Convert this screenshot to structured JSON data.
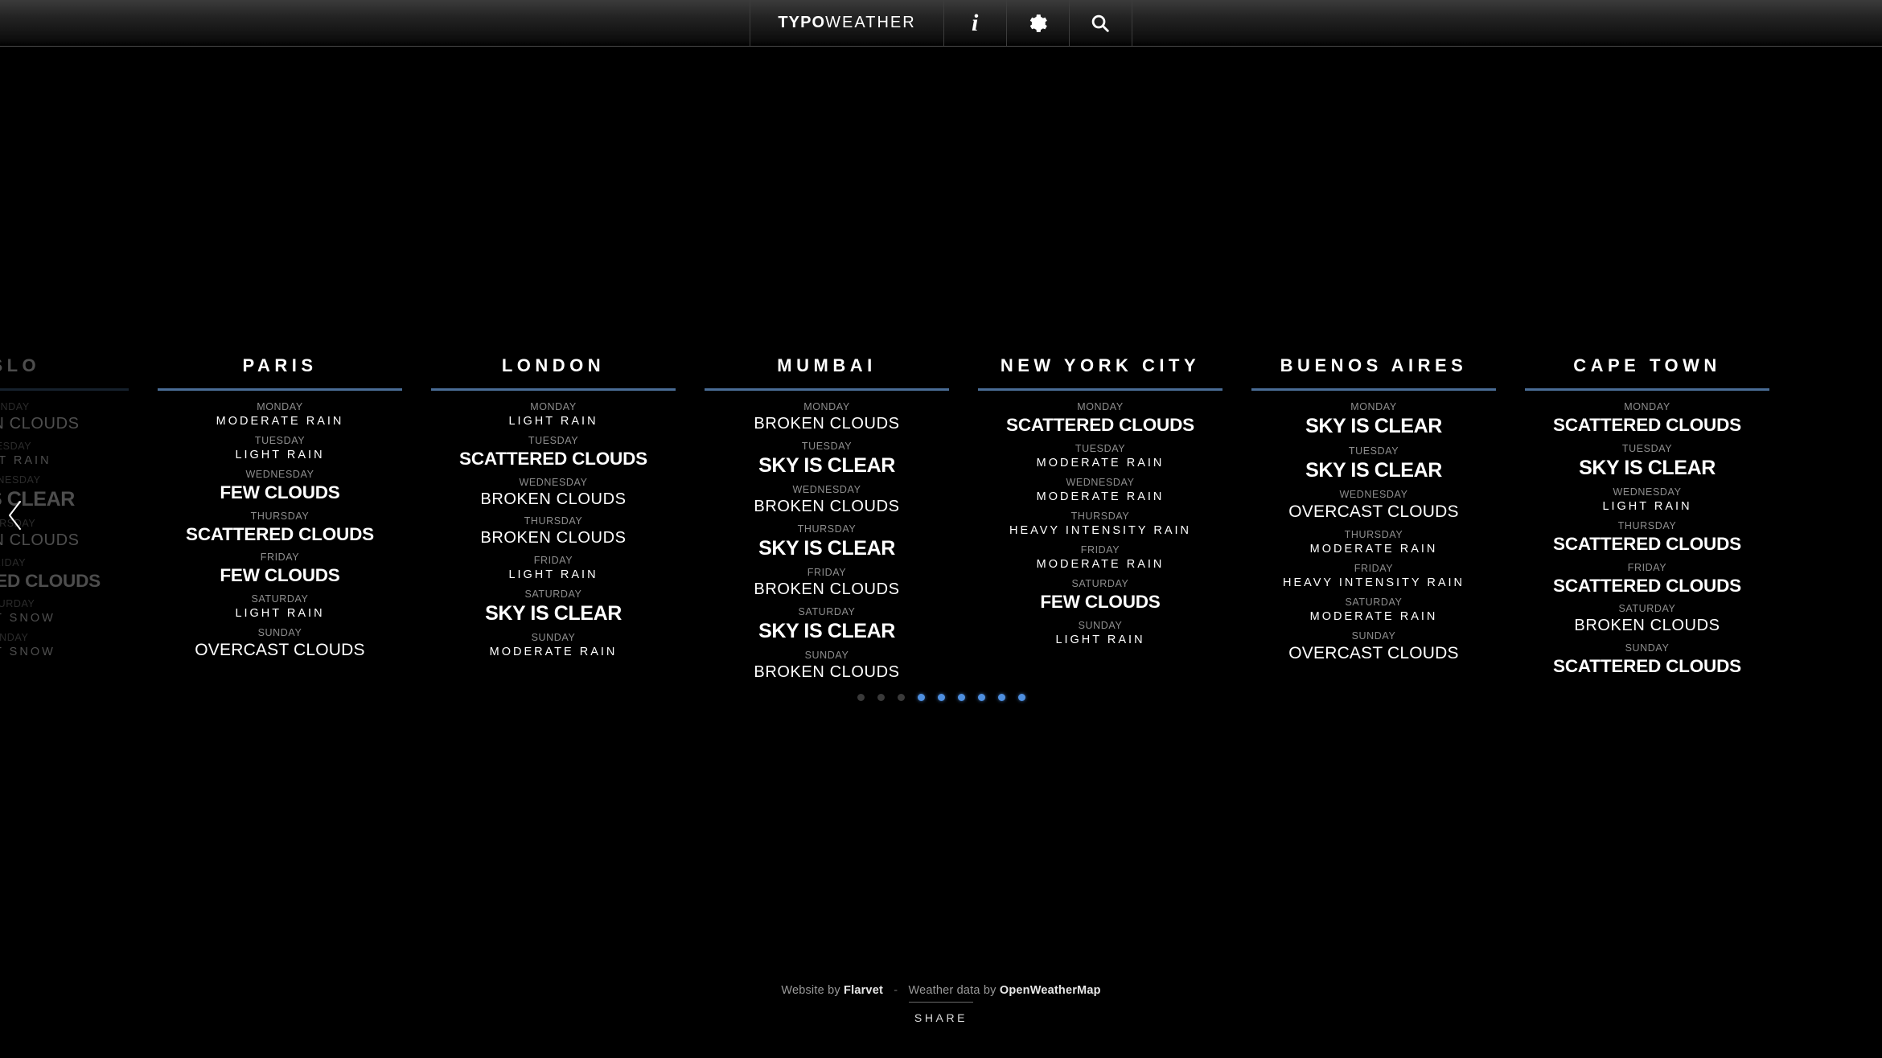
{
  "header": {
    "brand_bold": "TYPO",
    "brand_light": "WEATHER",
    "info_label": "i",
    "icons": {
      "info": "info-icon",
      "settings": "gear-icon",
      "search": "search-icon"
    }
  },
  "carousel": {
    "prev_label": "‹",
    "accent_color": "#4a6d96",
    "dot_active_color": "#4e8fe0",
    "dot_inactive_color": "#3a3a3a",
    "dots": [
      {
        "state": "off"
      },
      {
        "state": "off"
      },
      {
        "state": "off"
      },
      {
        "state": "on"
      },
      {
        "state": "on"
      },
      {
        "state": "on"
      },
      {
        "state": "on"
      },
      {
        "state": "on"
      },
      {
        "state": "on"
      }
    ],
    "cards": [
      {
        "city": "OSLO",
        "days": [
          {
            "day": "MONDAY",
            "condition": "BROKEN CLOUDS",
            "weight": "w-reg"
          },
          {
            "day": "TUESDAY",
            "condition": "LIGHT RAIN",
            "weight": "w-thin"
          },
          {
            "day": "WEDNESDAY",
            "condition": "SKY IS CLEAR",
            "weight": "w-xbold"
          },
          {
            "day": "THURSDAY",
            "condition": "BROKEN CLOUDS",
            "weight": "w-reg"
          },
          {
            "day": "FRIDAY",
            "condition": "SCATTERED CLOUDS",
            "weight": "w-bold"
          },
          {
            "day": "SATURDAY",
            "condition": "LIGHT SNOW",
            "weight": "w-thin"
          },
          {
            "day": "SUNDAY",
            "condition": "LIGHT SNOW",
            "weight": "w-thin"
          }
        ]
      },
      {
        "city": "PARIS",
        "days": [
          {
            "day": "MONDAY",
            "condition": "MODERATE RAIN",
            "weight": "w-thin"
          },
          {
            "day": "TUESDAY",
            "condition": "LIGHT RAIN",
            "weight": "w-thin"
          },
          {
            "day": "WEDNESDAY",
            "condition": "FEW CLOUDS",
            "weight": "w-bold"
          },
          {
            "day": "THURSDAY",
            "condition": "SCATTERED CLOUDS",
            "weight": "w-bold"
          },
          {
            "day": "FRIDAY",
            "condition": "FEW CLOUDS",
            "weight": "w-bold"
          },
          {
            "day": "SATURDAY",
            "condition": "LIGHT RAIN",
            "weight": "w-thin"
          },
          {
            "day": "SUNDAY",
            "condition": "OVERCAST CLOUDS",
            "weight": "w-mid"
          }
        ]
      },
      {
        "city": "LONDON",
        "days": [
          {
            "day": "MONDAY",
            "condition": "LIGHT RAIN",
            "weight": "w-thin"
          },
          {
            "day": "TUESDAY",
            "condition": "SCATTERED CLOUDS",
            "weight": "w-bold"
          },
          {
            "day": "WEDNESDAY",
            "condition": "BROKEN CLOUDS",
            "weight": "w-reg"
          },
          {
            "day": "THURSDAY",
            "condition": "BROKEN CLOUDS",
            "weight": "w-reg"
          },
          {
            "day": "FRIDAY",
            "condition": "LIGHT RAIN",
            "weight": "w-thin"
          },
          {
            "day": "SATURDAY",
            "condition": "SKY IS CLEAR",
            "weight": "w-xbold"
          },
          {
            "day": "SUNDAY",
            "condition": "MODERATE RAIN",
            "weight": "w-thin"
          }
        ]
      },
      {
        "city": "MUMBAI",
        "days": [
          {
            "day": "MONDAY",
            "condition": "BROKEN CLOUDS",
            "weight": "w-reg"
          },
          {
            "day": "TUESDAY",
            "condition": "SKY IS CLEAR",
            "weight": "w-xbold"
          },
          {
            "day": "WEDNESDAY",
            "condition": "BROKEN CLOUDS",
            "weight": "w-reg"
          },
          {
            "day": "THURSDAY",
            "condition": "SKY IS CLEAR",
            "weight": "w-xbold"
          },
          {
            "day": "FRIDAY",
            "condition": "BROKEN CLOUDS",
            "weight": "w-reg"
          },
          {
            "day": "SATURDAY",
            "condition": "SKY IS CLEAR",
            "weight": "w-xbold"
          },
          {
            "day": "SUNDAY",
            "condition": "BROKEN CLOUDS",
            "weight": "w-reg"
          }
        ]
      },
      {
        "city": "NEW YORK CITY",
        "days": [
          {
            "day": "MONDAY",
            "condition": "SCATTERED CLOUDS",
            "weight": "w-bold"
          },
          {
            "day": "TUESDAY",
            "condition": "MODERATE RAIN",
            "weight": "w-thin"
          },
          {
            "day": "WEDNESDAY",
            "condition": "MODERATE RAIN",
            "weight": "w-thin"
          },
          {
            "day": "THURSDAY",
            "condition": "HEAVY INTENSITY RAIN",
            "weight": "w-thin"
          },
          {
            "day": "FRIDAY",
            "condition": "MODERATE RAIN",
            "weight": "w-thin"
          },
          {
            "day": "SATURDAY",
            "condition": "FEW CLOUDS",
            "weight": "w-bold"
          },
          {
            "day": "SUNDAY",
            "condition": "LIGHT RAIN",
            "weight": "w-thin"
          }
        ]
      },
      {
        "city": "BUENOS AIRES",
        "days": [
          {
            "day": "MONDAY",
            "condition": "SKY IS CLEAR",
            "weight": "w-xbold"
          },
          {
            "day": "TUESDAY",
            "condition": "SKY IS CLEAR",
            "weight": "w-xbold"
          },
          {
            "day": "WEDNESDAY",
            "condition": "OVERCAST CLOUDS",
            "weight": "w-mid"
          },
          {
            "day": "THURSDAY",
            "condition": "MODERATE RAIN",
            "weight": "w-thin"
          },
          {
            "day": "FRIDAY",
            "condition": "HEAVY INTENSITY RAIN",
            "weight": "w-thin"
          },
          {
            "day": "SATURDAY",
            "condition": "MODERATE RAIN",
            "weight": "w-thin"
          },
          {
            "day": "SUNDAY",
            "condition": "OVERCAST CLOUDS",
            "weight": "w-mid"
          }
        ]
      },
      {
        "city": "CAPE TOWN",
        "days": [
          {
            "day": "MONDAY",
            "condition": "SCATTERED CLOUDS",
            "weight": "w-bold"
          },
          {
            "day": "TUESDAY",
            "condition": "SKY IS CLEAR",
            "weight": "w-xbold"
          },
          {
            "day": "WEDNESDAY",
            "condition": "LIGHT RAIN",
            "weight": "w-thin"
          },
          {
            "day": "THURSDAY",
            "condition": "SCATTERED CLOUDS",
            "weight": "w-bold"
          },
          {
            "day": "FRIDAY",
            "condition": "SCATTERED CLOUDS",
            "weight": "w-bold"
          },
          {
            "day": "SATURDAY",
            "condition": "BROKEN CLOUDS",
            "weight": "w-reg"
          },
          {
            "day": "SUNDAY",
            "condition": "SCATTERED CLOUDS",
            "weight": "w-bold"
          }
        ]
      }
    ]
  },
  "footer": {
    "website_by": "Website by",
    "website_author": "Flarvet",
    "separator": "-",
    "data_by": "Weather data by",
    "data_source": "OpenWeatherMap",
    "share_label": "SHARE"
  }
}
